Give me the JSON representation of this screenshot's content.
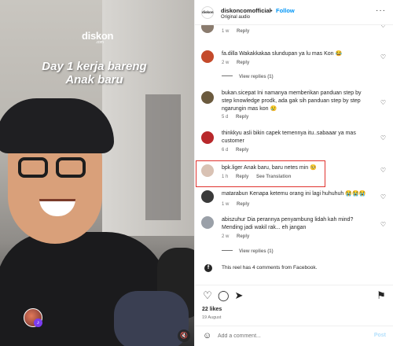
{
  "video": {
    "logo_text": "diskon",
    "logo_sub": ".com",
    "caption_line1": "Day 1 kerja bareng",
    "caption_line2": "Anak baru"
  },
  "header": {
    "avatar_text": "diskon",
    "username": "diskoncomofficial",
    "separator": "•",
    "follow_label": "Follow",
    "audio_label": "Original audio",
    "more_label": "···"
  },
  "comments": [
    {
      "user": "",
      "text": "",
      "time": "1 w",
      "reply": "Reply",
      "avatar_color": "#8a7b6e"
    },
    {
      "user": "fa.dilla",
      "text": "Wakakkakaa slundupan ya lu mas Kon 😂",
      "time": "2 w",
      "reply": "Reply",
      "avatar_color": "#c44a2b",
      "view_replies": "View replies (1)"
    },
    {
      "user": "bukan.sicepat",
      "text": "Ini namanya memberikan panduan step by step knowledge prodk, ada gak sih panduan step by step ngarungin mas kon 😢",
      "time": "5 d",
      "reply": "Reply",
      "avatar_color": "#6b5a3e"
    },
    {
      "user": "thinkkyu",
      "text": "asli bikin capek temennya itu..sabaaar ya mas customer",
      "time": "6 d",
      "reply": "Reply",
      "avatar_color": "#b8282b"
    },
    {
      "user": "bpk.liger",
      "text": "Anak baru, baru netes min 🥺",
      "time": "1 h",
      "reply": "Reply",
      "translate": "See Translation",
      "avatar_color": "#d9c2b4"
    },
    {
      "user": "matarabun",
      "text": "Kenapa ketemu orang ini lagi huhuhuh 😭😭😭",
      "time": "1 w",
      "reply": "Reply",
      "avatar_color": "#3a3a3a"
    },
    {
      "user": "abiszuhur",
      "text": "Dia perannya penyambung lidah kah mind? Mending jadi wakil rak... eh jangan",
      "time": "2 w",
      "reply": "Reply",
      "avatar_color": "#9aa0a8",
      "view_replies": "View replies (1)"
    }
  ],
  "facebook_note": "This reel has 4 comments from Facebook.",
  "actions": {
    "likes": "22 likes",
    "date": "19 August"
  },
  "compose": {
    "placeholder": "Add a comment...",
    "post_label": "Post"
  },
  "colors": {
    "accent": "#0095f6",
    "highlight": "#e0322e"
  }
}
